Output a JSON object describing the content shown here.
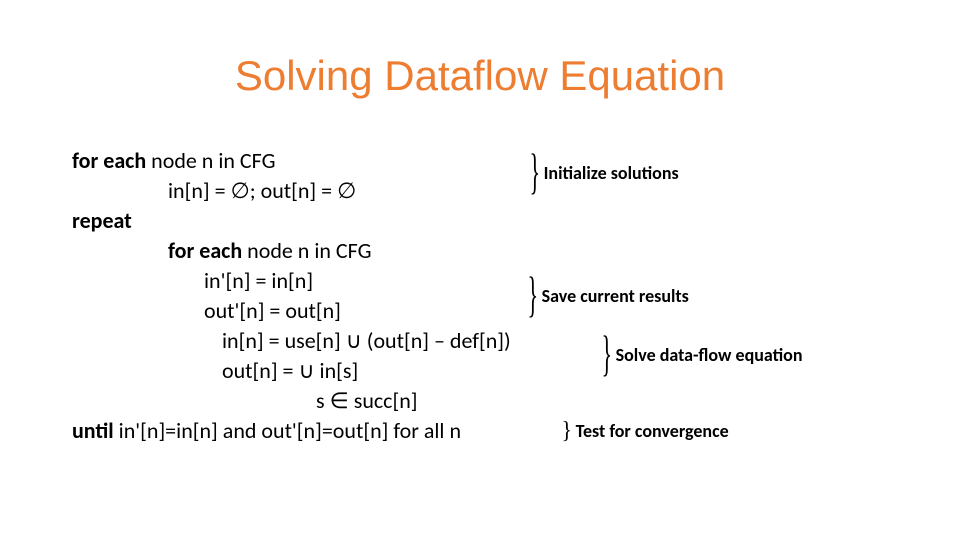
{
  "title": "Solving Dataflow Equation",
  "algo": {
    "line1": {
      "kw": "for each ",
      "rest": "node n in CFG"
    },
    "line2": "in[n] = ∅; out[n] = ∅",
    "line3": "repeat",
    "line4": {
      "kw": "for each ",
      "rest": "node n in CFG"
    },
    "line5": "in'[n] = in[n]",
    "line6": "out'[n] = out[n]",
    "line7": "in[n] = use[n] ∪ (out[n] – def[n])",
    "line8": "out[n] = ∪ in[s]",
    "line9": "s ∈ succ[n]",
    "line10": {
      "kw": "until ",
      "rest": "in'[n]=in[n] and out'[n]=out[n] for all n"
    }
  },
  "annotations": {
    "a1": "Initialize solutions",
    "a2": "Save current results",
    "a3": "Solve data-flow equation",
    "a4": "Test for convergence"
  }
}
